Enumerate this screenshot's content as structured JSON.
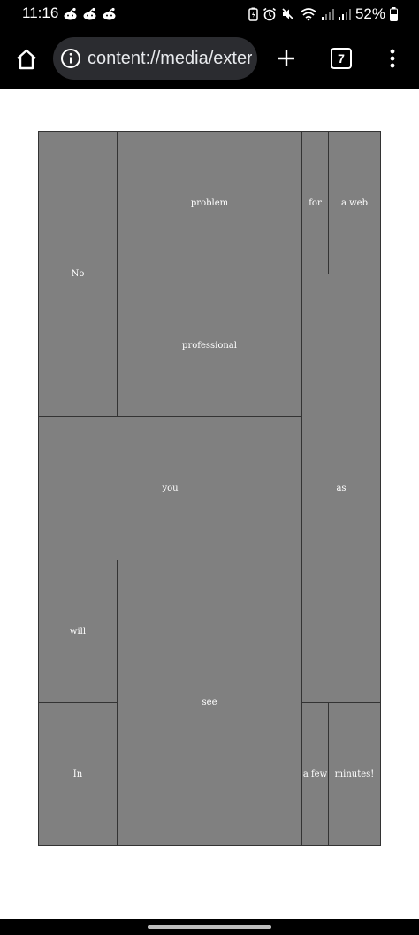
{
  "status_bar": {
    "time": "11:16",
    "notification_icons": [
      "reddit-icon",
      "reddit-icon",
      "reddit-icon"
    ],
    "system_icons": [
      "battery-saver-icon",
      "alarm-icon",
      "mute-icon",
      "wifi-icon",
      "signal-icon",
      "signal-icon"
    ],
    "battery_percent": "52%"
  },
  "toolbar": {
    "url": "content://media/external/file",
    "tab_count": "7"
  },
  "mosaic": {
    "cells": [
      {
        "text": "No"
      },
      {
        "text": "problem"
      },
      {
        "text": "for"
      },
      {
        "text": "a web"
      },
      {
        "text": "professional"
      },
      {
        "text": "as"
      },
      {
        "text": "you"
      },
      {
        "text": "will"
      },
      {
        "text": "see"
      },
      {
        "text": "In"
      },
      {
        "text": "a few"
      },
      {
        "text": "minutes!"
      }
    ],
    "cell_color": "#808080",
    "border_color": "#333333",
    "text_color": "#ffffff"
  }
}
